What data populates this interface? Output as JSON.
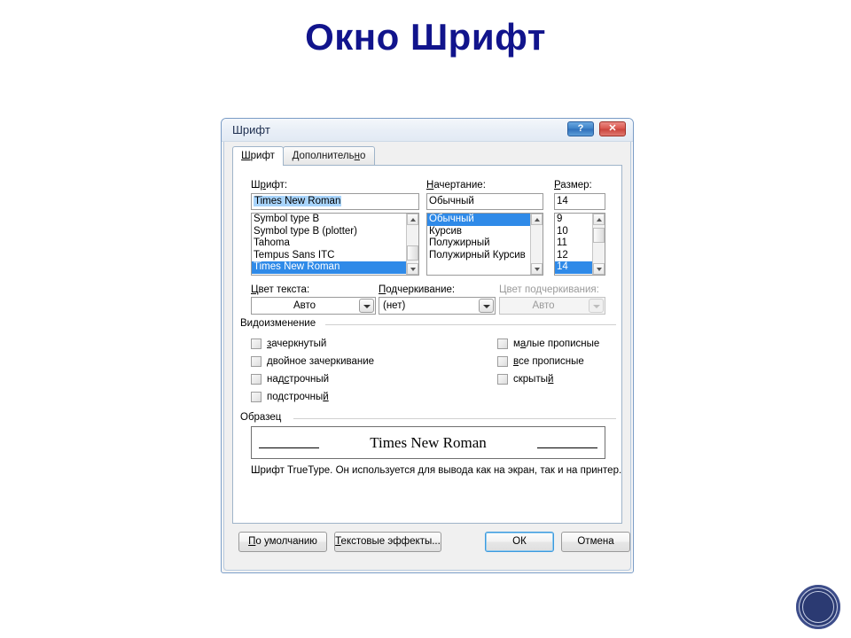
{
  "slide": {
    "title": "Окно Шрифт",
    "title_color": "#11148c",
    "background": "#ffffff"
  },
  "logo": {
    "name": "institution-seal",
    "color": "#2b3a72"
  },
  "dialog": {
    "titlebar": {
      "title": "Шрифт",
      "help_button": "?",
      "close_button": "✕",
      "help_color": "#3e82c8",
      "close_color": "#d9564e"
    },
    "tabs": [
      {
        "label": "Шрифт",
        "accel": "Ш",
        "active": true
      },
      {
        "label": "Дополнительно",
        "accel": "н",
        "active": false
      }
    ],
    "font_section": {
      "font": {
        "label": "Шрифт:",
        "value": "Times New Roman",
        "items": [
          "Symbol type B",
          "Symbol type B (plotter)",
          "Tahoma",
          "Tempus Sans ITC",
          "Times New Roman"
        ],
        "selected_index": 4
      },
      "style": {
        "label": "Начертание:",
        "value": "Обычный",
        "items": [
          "Обычный",
          "Курсив",
          "Полужирный",
          "Полужирный Курсив"
        ],
        "selected_index": 0
      },
      "size": {
        "label": "Размер:",
        "value": "14",
        "items": [
          "9",
          "10",
          "11",
          "12",
          "14"
        ],
        "selected_index": 4
      }
    },
    "color_row": {
      "text_color": {
        "label": "Цвет текста:",
        "value": "Авто",
        "disabled": false
      },
      "underline_style": {
        "label": "Подчеркивание:",
        "value": "(нет)",
        "disabled": false
      },
      "underline_color": {
        "label": "Цвет подчеркивания:",
        "value": "Авто",
        "disabled": true
      }
    },
    "effects": {
      "group_title": "Видоизменение",
      "left_column": [
        {
          "label": "зачеркнутый",
          "checked": false
        },
        {
          "label": "двойное зачеркивание",
          "checked": false
        },
        {
          "label": "надстрочный",
          "checked": false
        },
        {
          "label": "подстрочный",
          "checked": false
        }
      ],
      "right_column": [
        {
          "label": "малые прописные",
          "checked": false
        },
        {
          "label": "все прописные",
          "checked": false
        },
        {
          "label": "скрытый",
          "checked": false
        }
      ]
    },
    "sample": {
      "group_title": "Образец",
      "text": "Times New Roman",
      "note": "Шрифт TrueType. Он используется для вывода как на экран, так и на принтер."
    },
    "footer": {
      "default_button": "По умолчанию",
      "text_effects_button": "Текстовые эффекты...",
      "ok_button": "ОК",
      "cancel_button": "Отмена"
    }
  }
}
